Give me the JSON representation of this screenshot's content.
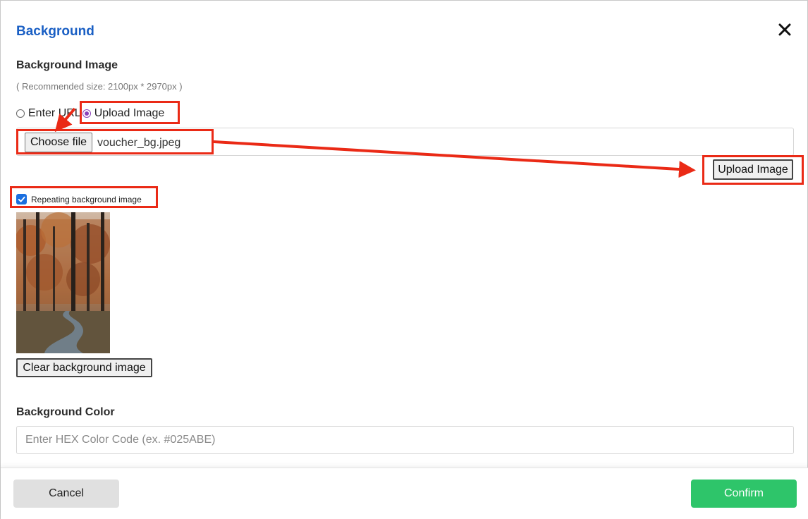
{
  "dialog": {
    "title": "Background",
    "close_icon": "close-icon"
  },
  "background_image": {
    "label": "Background Image",
    "hint": "( Recommended size: 2100px * 2970px )",
    "options": [
      {
        "label": "Enter URL",
        "selected": false
      },
      {
        "label": "Upload Image",
        "selected": true
      }
    ],
    "choose_file_label": "Choose file",
    "file_name": "voucher_bg.jpeg",
    "upload_button": "Upload Image",
    "repeat_label": "Repeating background image",
    "repeat_checked": true,
    "clear_button": "Clear background image"
  },
  "background_color": {
    "label": "Background Color",
    "placeholder": "Enter HEX Color Code (ex. #025ABE)",
    "value": ""
  },
  "footer": {
    "cancel": "Cancel",
    "confirm": "Confirm"
  },
  "colors": {
    "title": "#1a5fc4",
    "confirm": "#2ec56a",
    "cancel": "#e0e0e0",
    "annotation": "#ea2a16",
    "checkbox": "#1a6fe0",
    "radio": "#8a3fb8"
  }
}
